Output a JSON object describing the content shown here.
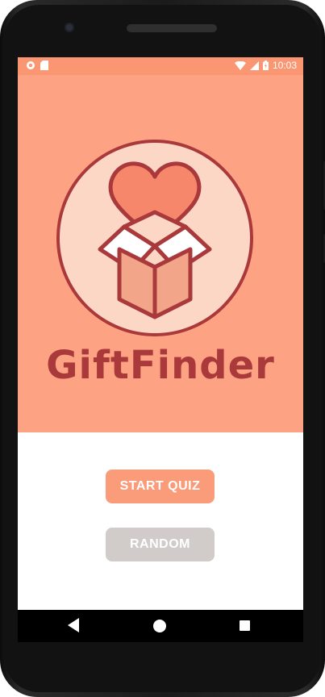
{
  "status_bar": {
    "time": "10:03",
    "icons": [
      "settings-gear-icon",
      "sd-card-icon",
      "wifi-icon",
      "signal-icon",
      "battery-icon"
    ]
  },
  "app": {
    "title": "GiftFinder",
    "logo": "heart-gift-box-icon"
  },
  "buttons": {
    "start_quiz": "START QUIZ",
    "random": "RANDOM"
  },
  "nav": {
    "icons": [
      "back-icon",
      "home-icon",
      "recents-icon"
    ]
  },
  "colors": {
    "primary": "#fda283",
    "accent_dark": "#a9393b",
    "button_start": "#fa9b7a",
    "button_random": "#d1ccc9"
  }
}
